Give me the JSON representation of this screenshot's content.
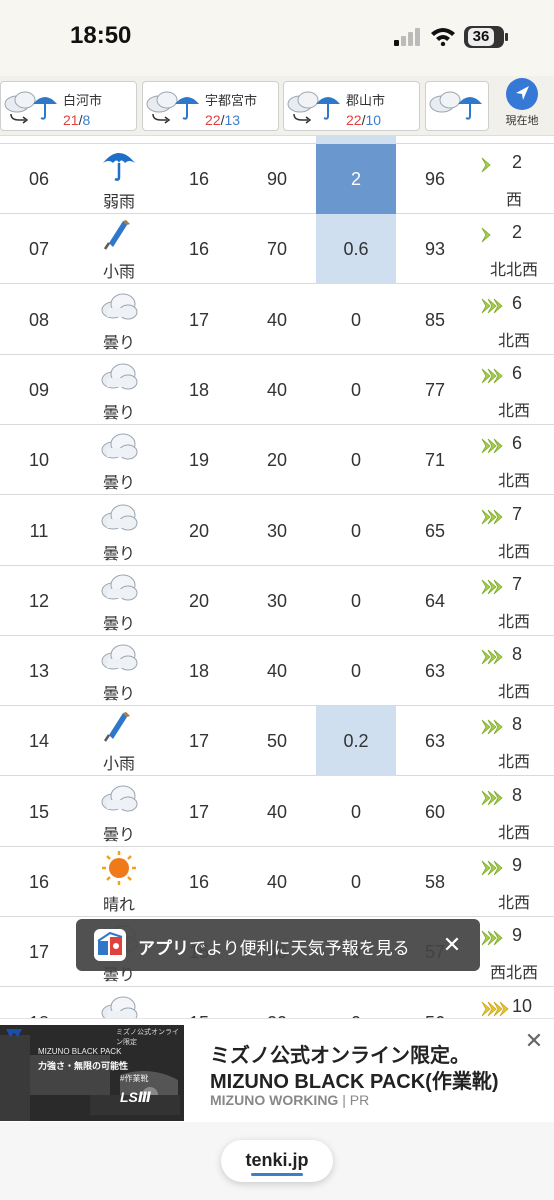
{
  "status_bar": {
    "time": "18:50",
    "battery": "36"
  },
  "cities": [
    {
      "name": "白河市",
      "high": "21",
      "low": "8",
      "icon": "rain-cloud-icon"
    },
    {
      "name": "宇都宮市",
      "high": "22",
      "low": "13",
      "icon": "rain-cloud-icon"
    },
    {
      "name": "郡山市",
      "high": "22",
      "low": "10",
      "icon": "rain-cloud-icon"
    },
    {
      "name": "",
      "high": "",
      "low": "",
      "icon": "rain-cloud-icon"
    }
  ],
  "temp_separator": "/",
  "locate": {
    "label": "現在地",
    "icon": "location-arrow-icon"
  },
  "rows": [
    {
      "hour": "06",
      "weather": "弱雨",
      "icon": "umbrella-icon",
      "temp": "16",
      "prob": "90",
      "precip": "2",
      "humidity": "96",
      "wind_speed": "2",
      "wind_dir": "西",
      "precip_level": "strong",
      "wind_level": 1
    },
    {
      "hour": "07",
      "weather": "小雨",
      "icon": "closed-umbrella-icon",
      "temp": "16",
      "prob": "70",
      "precip": "0.6",
      "humidity": "93",
      "wind_speed": "2",
      "wind_dir": "北北西",
      "precip_level": "light",
      "wind_level": 1
    },
    {
      "hour": "08",
      "weather": "曇り",
      "icon": "cloud-icon",
      "temp": "17",
      "prob": "40",
      "precip": "0",
      "humidity": "85",
      "wind_speed": "6",
      "wind_dir": "北西",
      "precip_level": "none",
      "wind_level": 3
    },
    {
      "hour": "09",
      "weather": "曇り",
      "icon": "cloud-icon",
      "temp": "18",
      "prob": "40",
      "precip": "0",
      "humidity": "77",
      "wind_speed": "6",
      "wind_dir": "北西",
      "precip_level": "none",
      "wind_level": 3
    },
    {
      "hour": "10",
      "weather": "曇り",
      "icon": "cloud-icon",
      "temp": "19",
      "prob": "20",
      "precip": "0",
      "humidity": "71",
      "wind_speed": "6",
      "wind_dir": "北西",
      "precip_level": "none",
      "wind_level": 3
    },
    {
      "hour": "11",
      "weather": "曇り",
      "icon": "cloud-icon",
      "temp": "20",
      "prob": "30",
      "precip": "0",
      "humidity": "65",
      "wind_speed": "7",
      "wind_dir": "北西",
      "precip_level": "none",
      "wind_level": 3
    },
    {
      "hour": "12",
      "weather": "曇り",
      "icon": "cloud-icon",
      "temp": "20",
      "prob": "30",
      "precip": "0",
      "humidity": "64",
      "wind_speed": "7",
      "wind_dir": "北西",
      "precip_level": "none",
      "wind_level": 3
    },
    {
      "hour": "13",
      "weather": "曇り",
      "icon": "cloud-icon",
      "temp": "18",
      "prob": "40",
      "precip": "0",
      "humidity": "63",
      "wind_speed": "8",
      "wind_dir": "北西",
      "precip_level": "none",
      "wind_level": 3
    },
    {
      "hour": "14",
      "weather": "小雨",
      "icon": "closed-umbrella-icon",
      "temp": "17",
      "prob": "50",
      "precip": "0.2",
      "humidity": "63",
      "wind_speed": "8",
      "wind_dir": "北西",
      "precip_level": "light",
      "wind_level": 3
    },
    {
      "hour": "15",
      "weather": "曇り",
      "icon": "cloud-icon",
      "temp": "17",
      "prob": "40",
      "precip": "0",
      "humidity": "60",
      "wind_speed": "8",
      "wind_dir": "北西",
      "precip_level": "none",
      "wind_level": 3
    },
    {
      "hour": "16",
      "weather": "晴れ",
      "icon": "sun-icon",
      "temp": "16",
      "prob": "40",
      "precip": "0",
      "humidity": "58",
      "wind_speed": "9",
      "wind_dir": "北西",
      "precip_level": "none",
      "wind_level": 3
    },
    {
      "hour": "17",
      "weather": "曇り",
      "icon": "cloud-icon",
      "temp": "15",
      "prob": "40",
      "precip": "0",
      "humidity": "57",
      "wind_speed": "9",
      "wind_dir": "西北西",
      "precip_level": "none",
      "wind_level": 3
    },
    {
      "hour": "18",
      "weather": "",
      "icon": "cloud-icon",
      "temp": "15",
      "prob": "20",
      "precip": "0",
      "humidity": "56",
      "wind_speed": "10",
      "wind_dir": "",
      "precip_level": "none",
      "wind_level": 4
    }
  ],
  "toast": {
    "bold_text": "アプリ",
    "text": "でより便利に天気予報を見る",
    "close": "✕",
    "icon": "tenki-app-icon"
  },
  "ad": {
    "headline1": "ミズノ公式オンライン限定。",
    "headline2": "MIZUNO BLACK PACK(作業靴)",
    "sponsor": "MIZUNO WORKING",
    "pr_label": "PR",
    "close": "✕",
    "image_caption_1": "ミズノ公式オンライン限定",
    "image_caption_2": "MIZUNO BLACK PACK",
    "image_caption_3": "力強さ・無限の可能性",
    "image_caption_4": "#作業靴",
    "image_caption_5": "LSⅢ"
  },
  "brand": {
    "label": "tenki.jp"
  },
  "colors": {
    "accent": "#3678d6",
    "high_temp": "#e0413f",
    "low_temp": "#3b7ec9",
    "precip_strong": "#6b97cf",
    "precip_light": "#cfdff0",
    "wind_green": "#a9cf4a",
    "wind_yellow": "#e8c62c"
  }
}
